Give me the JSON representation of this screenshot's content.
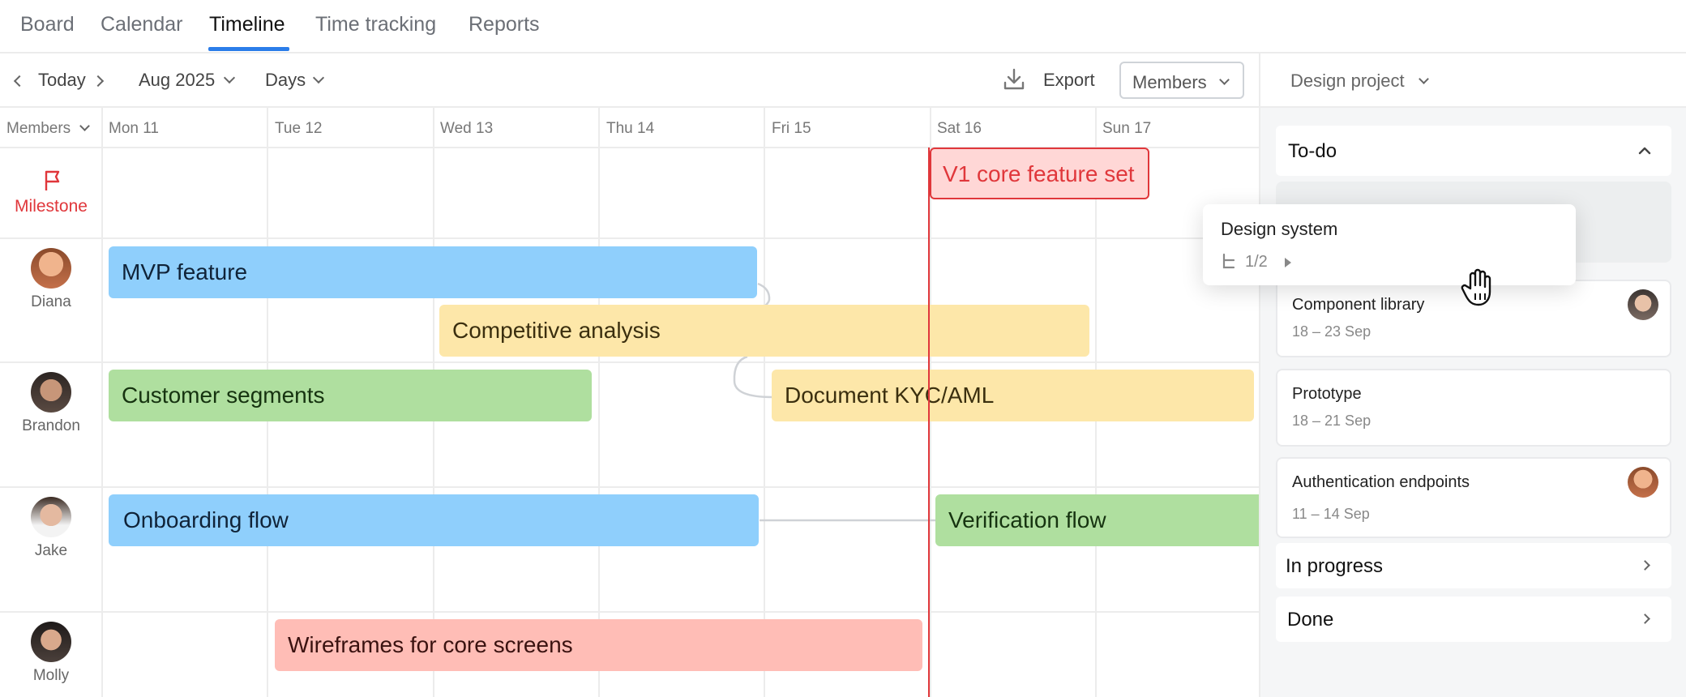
{
  "tabs": [
    {
      "label": "Board",
      "active": false
    },
    {
      "label": "Calendar",
      "active": false
    },
    {
      "label": "Timeline",
      "active": true
    },
    {
      "label": "Time tracking",
      "active": false
    },
    {
      "label": "Reports",
      "active": false
    }
  ],
  "toolbar": {
    "today_label": "Today",
    "month_label": "Aug 2025",
    "scale_label": "Days",
    "export_label": "Export",
    "members_label": "Members"
  },
  "grid": {
    "members_header": "Members",
    "days": [
      "Mon 11",
      "Tue 12",
      "Wed 13",
      "Thu 14",
      "Fri 15",
      "Sat 16",
      "Sun 17"
    ],
    "milestone_label": "Milestone",
    "milestone_name": "V1 core feature set",
    "members": [
      {
        "name": "Diana"
      },
      {
        "name": "Brandon"
      },
      {
        "name": "Jake"
      },
      {
        "name": "Molly"
      }
    ],
    "tasks": {
      "mvp": "MVP feature",
      "competitive": "Competitive analysis",
      "segments": "Customer segments",
      "kyc": "Document KYC/AML",
      "onboarding": "Onboarding flow",
      "verification": "Verification flow",
      "wireframes": "Wireframes for core screens"
    }
  },
  "panel": {
    "project_label": "Design project",
    "todo_label": "To-do",
    "inprogress_label": "In progress",
    "done_label": "Done",
    "cards": [
      {
        "title": "Component library",
        "dates": "18 – 23 Sep"
      },
      {
        "title": "Prototype",
        "dates": "18 – 21 Sep"
      },
      {
        "title": "Authentication endpoints",
        "dates": "11 – 14 Sep"
      }
    ]
  },
  "drag_card": {
    "title": "Design system",
    "subtasks": "1/2"
  },
  "colors": {
    "accent": "#2b7de9",
    "milestone": "#e0373b",
    "blue": "#8fcffc",
    "yellow": "#fde7a9",
    "green": "#afdf9f",
    "red": "#ffbdb6"
  }
}
